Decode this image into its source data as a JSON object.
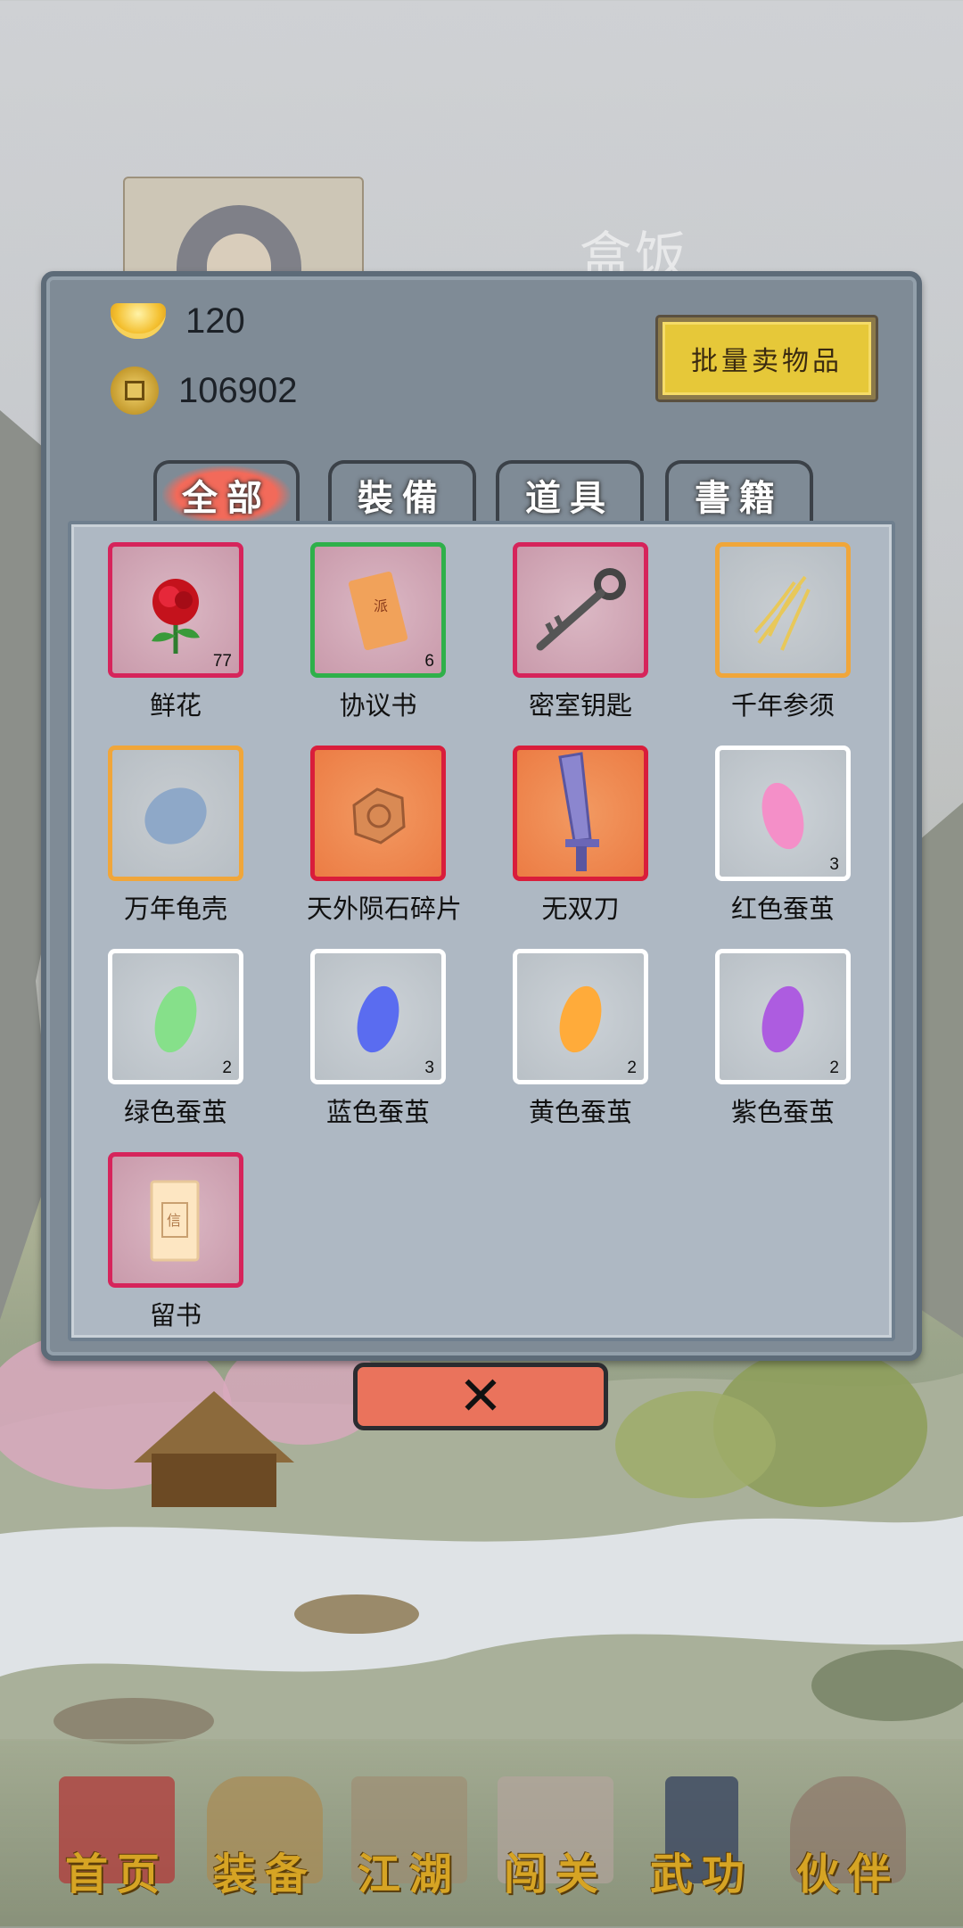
{
  "background": {
    "title_ghost": "盒饭"
  },
  "currency": {
    "gold": {
      "icon": "gold-ingot-icon",
      "value": "120"
    },
    "coins": {
      "icon": "copper-coin-icon",
      "value": "106902"
    }
  },
  "sell_button": {
    "label": "批量卖物品"
  },
  "tabs": [
    {
      "label": "全部",
      "active": true
    },
    {
      "label": "裝備",
      "active": false
    },
    {
      "label": "道具",
      "active": false
    },
    {
      "label": "書籍",
      "active": false
    }
  ],
  "items": [
    {
      "name": "鲜花",
      "count": "77",
      "quality": "pink",
      "icon": "rose-icon"
    },
    {
      "name": "协议书",
      "count": "6",
      "quality": "green",
      "icon": "agreement-scroll-icon"
    },
    {
      "name": "密室钥匙",
      "count": "",
      "quality": "pink",
      "icon": "key-icon"
    },
    {
      "name": "千年参须",
      "count": "",
      "quality": "orange",
      "icon": "ginseng-root-icon"
    },
    {
      "name": "万年龟壳",
      "count": "",
      "quality": "orange",
      "icon": "turtle-shell-icon"
    },
    {
      "name": "天外陨石碎片",
      "count": "",
      "quality": "red",
      "icon": "meteorite-fragment-icon"
    },
    {
      "name": "无双刀",
      "count": "",
      "quality": "red",
      "icon": "sword-icon"
    },
    {
      "name": "红色蚕茧",
      "count": "3",
      "quality": "white",
      "icon": "cocoon-icon",
      "color": "#f48fc8"
    },
    {
      "name": "绿色蚕茧",
      "count": "2",
      "quality": "white",
      "icon": "cocoon-icon",
      "color": "#86e08a"
    },
    {
      "name": "蓝色蚕茧",
      "count": "3",
      "quality": "white",
      "icon": "cocoon-icon",
      "color": "#5a6cf0"
    },
    {
      "name": "黄色蚕茧",
      "count": "2",
      "quality": "white",
      "icon": "cocoon-icon",
      "color": "#ffab3a"
    },
    {
      "name": "紫色蚕茧",
      "count": "2",
      "quality": "white",
      "icon": "cocoon-icon",
      "color": "#ad5ce0"
    },
    {
      "name": "留书",
      "count": "",
      "quality": "pink",
      "icon": "letter-icon"
    }
  ],
  "close_button": {
    "label": "✕"
  },
  "nav": [
    {
      "label": "首页",
      "icon": "house-icon",
      "color": "#b23a3a"
    },
    {
      "label": "装备",
      "icon": "armor-icon",
      "color": "#a98a52"
    },
    {
      "label": "江湖",
      "icon": "scroll-map-icon",
      "color": "#9e8a70"
    },
    {
      "label": "闯关",
      "icon": "crossed-swords-icon",
      "color": "#b7a5a0"
    },
    {
      "label": "武功",
      "icon": "martial-book-icon",
      "color": "#3a4660"
    },
    {
      "label": "伙伴",
      "icon": "companions-icon",
      "color": "#8a6c60"
    }
  ]
}
